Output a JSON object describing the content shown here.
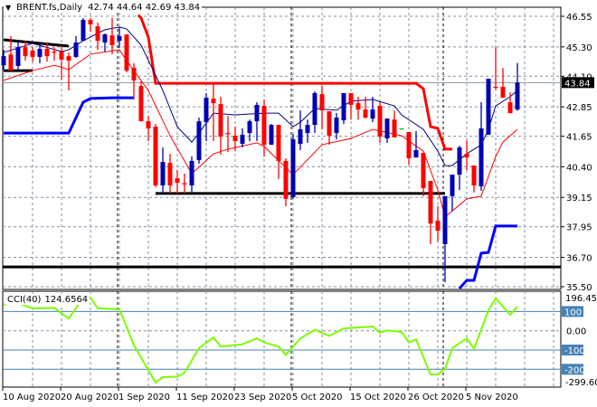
{
  "header": {
    "symbol": "BRENT.fs,Daily",
    "ohlc": "42.74 44.64 42.69 43.84"
  },
  "cci_header": {
    "name": "CCI(40)",
    "value": "124.6564"
  },
  "colors": {
    "bull": "#0000b0",
    "bear": "#ff0000",
    "doji": "#00c000",
    "ma": "#000080",
    "lower_env": "#ff0000",
    "upper_channel": "#ff0000",
    "lower_channel": "#0000ff",
    "cci": "#7cfc00",
    "level_box": "#4682b4"
  },
  "chart_data": [
    {
      "type": "candlestick",
      "title": "BRENT.fs,Daily",
      "ylim": [
        35.5,
        46.55
      ],
      "yticks": [
        "46.55",
        "45.30",
        "44.10",
        "42.85",
        "41.65",
        "40.40",
        "39.15",
        "37.95",
        "36.70",
        "35.50"
      ],
      "current_price": "43.84",
      "xticks": [
        {
          "bar": 0,
          "label": "10 Aug 2020"
        },
        {
          "bar": 8,
          "label": "20 Aug 2020"
        },
        {
          "bar": 16,
          "label": "1 Sep 2020"
        },
        {
          "bar": 24,
          "label": "11 Sep 2020"
        },
        {
          "bar": 32,
          "label": "23 Sep 2020"
        },
        {
          "bar": 40,
          "label": "5 Oct 2020"
        },
        {
          "bar": 48,
          "label": "15 Oct 2020"
        },
        {
          "bar": 56,
          "label": "26 Oct 2020"
        },
        {
          "bar": 64,
          "label": "5 Nov 2020"
        }
      ],
      "period_separators": [
        16,
        40,
        61
      ],
      "ohlc": [
        [
          44.55,
          45.18,
          44.37,
          44.92
        ],
        [
          44.99,
          45.74,
          44.33,
          44.33
        ],
        [
          44.52,
          45.55,
          44.37,
          45.29
        ],
        [
          45.29,
          45.55,
          44.74,
          44.92
        ],
        [
          45.15,
          45.29,
          44.7,
          44.89
        ],
        [
          44.89,
          45.44,
          44.63,
          45.22
        ],
        [
          45.22,
          45.48,
          44.7,
          44.92
        ],
        [
          45.11,
          45.29,
          44.74,
          45.07
        ],
        [
          45.11,
          45.33,
          43.96,
          44.78
        ],
        [
          44.92,
          45.07,
          43.52,
          44.74
        ],
        [
          44.89,
          45.74,
          44.85,
          45.48
        ],
        [
          45.55,
          46.48,
          45.55,
          46.4
        ],
        [
          46.4,
          46.48,
          45.92,
          46.22
        ],
        [
          46.14,
          46.29,
          45.18,
          45.55
        ],
        [
          45.48,
          45.85,
          45.11,
          45.81
        ],
        [
          45.77,
          46.48,
          45.0,
          45.37
        ],
        [
          45.55,
          46.11,
          45.26,
          45.74
        ],
        [
          45.81,
          45.81,
          44.26,
          44.33
        ],
        [
          44.44,
          44.63,
          43.15,
          43.93
        ],
        [
          43.7,
          43.89,
          42.26,
          42.26
        ],
        [
          42.26,
          42.48,
          41.45,
          41.97
        ],
        [
          42.04,
          42.15,
          39.57,
          39.64
        ],
        [
          39.64,
          41.19,
          39.31,
          40.6
        ],
        [
          40.56,
          40.93,
          39.31,
          39.64
        ],
        [
          39.93,
          40.27,
          39.31,
          39.75
        ],
        [
          39.73,
          40.12,
          39.31,
          39.7
        ],
        [
          39.64,
          40.82,
          39.31,
          40.64
        ],
        [
          40.67,
          42.41,
          40.53,
          42.26
        ],
        [
          42.22,
          43.41,
          41.45,
          43.22
        ],
        [
          43.18,
          43.81,
          41.45,
          43.0
        ],
        [
          42.96,
          43.26,
          40.89,
          41.63
        ],
        [
          41.78,
          42.48,
          41.0,
          41.74
        ],
        [
          41.67,
          42.04,
          41.04,
          41.45
        ],
        [
          41.34,
          41.97,
          41.19,
          41.71
        ],
        [
          41.78,
          42.33,
          41.45,
          42.26
        ],
        [
          42.26,
          43.04,
          41.45,
          42.93
        ],
        [
          42.89,
          43.15,
          40.82,
          41.3
        ],
        [
          41.3,
          42.15,
          41.3,
          42.11
        ],
        [
          42.11,
          42.11,
          39.9,
          40.64
        ],
        [
          40.64,
          40.75,
          38.79,
          39.09
        ],
        [
          39.16,
          41.74,
          39.09,
          41.52
        ],
        [
          41.34,
          42.7,
          41.08,
          41.93
        ],
        [
          41.78,
          42.33,
          41.38,
          42.11
        ],
        [
          42.11,
          43.48,
          41.78,
          43.41
        ],
        [
          43.37,
          43.7,
          41.93,
          42.7
        ],
        [
          42.67,
          42.67,
          41.3,
          41.67
        ],
        [
          41.78,
          42.6,
          41.52,
          42.41
        ],
        [
          42.3,
          43.41,
          42.15,
          43.41
        ],
        [
          43.41,
          43.41,
          42.33,
          42.93
        ],
        [
          43.0,
          43.26,
          42.33,
          42.74
        ],
        [
          42.74,
          43.26,
          42.37,
          42.41
        ],
        [
          42.37,
          43.26,
          42.22,
          42.74
        ],
        [
          42.89,
          43.04,
          41.38,
          41.63
        ],
        [
          41.56,
          42.37,
          41.38,
          42.37
        ],
        [
          42.33,
          42.7,
          41.6,
          41.6
        ],
        [
          41.97,
          41.97,
          41.97,
          41.97
        ],
        [
          41.82,
          41.82,
          40.49,
          40.75
        ],
        [
          40.78,
          41.86,
          40.78,
          41.08
        ],
        [
          40.97,
          40.97,
          39.2,
          39.53
        ],
        [
          39.82,
          39.82,
          37.24,
          38.08
        ],
        [
          38.2,
          38.79,
          37.35,
          37.79
        ],
        [
          37.24,
          39.2,
          35.68,
          39.2
        ],
        [
          39.2,
          40.08,
          38.6,
          40.08
        ],
        [
          40.08,
          41.26,
          39.45,
          41.19
        ],
        [
          40.93,
          41.48,
          40.27,
          40.78
        ],
        [
          40.45,
          40.45,
          39.35,
          39.64
        ],
        [
          39.6,
          43.04,
          39.42,
          41.97
        ],
        [
          41.71,
          44.0,
          41.71,
          44.0
        ],
        [
          43.67,
          45.29,
          43.56,
          43.63
        ],
        [
          43.67,
          44.44,
          43.22,
          43.22
        ],
        [
          43.04,
          43.44,
          42.59,
          42.59
        ],
        [
          42.74,
          44.64,
          42.69,
          43.84
        ]
      ],
      "lines": {
        "ma": [
          [
            0,
            45.07
          ],
          [
            4,
            45.44
          ],
          [
            8,
            45.11
          ],
          [
            9,
            45.18
          ],
          [
            11,
            45.55
          ],
          [
            14,
            46.0
          ],
          [
            16,
            46.11
          ],
          [
            17,
            46.03
          ],
          [
            19,
            45.37
          ],
          [
            22,
            43.52
          ],
          [
            24,
            42.04
          ],
          [
            26,
            41.41
          ],
          [
            27,
            41.78
          ],
          [
            29,
            42.59
          ],
          [
            32,
            42.52
          ],
          [
            36,
            42.59
          ],
          [
            38,
            42.59
          ],
          [
            40,
            42.04
          ],
          [
            41,
            42.22
          ],
          [
            43,
            42.78
          ],
          [
            46,
            42.71
          ],
          [
            48,
            43.08
          ],
          [
            51,
            43.15
          ],
          [
            54,
            42.89
          ],
          [
            55,
            42.52
          ],
          [
            58,
            41.93
          ],
          [
            60,
            41.04
          ],
          [
            61,
            40.45
          ],
          [
            62,
            40.45
          ],
          [
            64,
            40.93
          ],
          [
            66,
            41.3
          ],
          [
            67,
            41.93
          ],
          [
            68,
            42.89
          ],
          [
            70,
            43.26
          ],
          [
            71,
            43.52
          ]
        ],
        "lower_env": [
          [
            0,
            43.93
          ],
          [
            4,
            44.33
          ],
          [
            7,
            44.55
          ],
          [
            9,
            44.37
          ],
          [
            12,
            45.0
          ],
          [
            16,
            45.18
          ],
          [
            17,
            44.74
          ],
          [
            20,
            43.52
          ],
          [
            23,
            41.67
          ],
          [
            26,
            40.12
          ],
          [
            29,
            40.93
          ],
          [
            31,
            41.12
          ],
          [
            35,
            41.38
          ],
          [
            36,
            41.23
          ],
          [
            40,
            40.08
          ],
          [
            44,
            41.3
          ],
          [
            48,
            41.56
          ],
          [
            51,
            41.93
          ],
          [
            55,
            41.67
          ],
          [
            58,
            41.04
          ],
          [
            60,
            39.45
          ],
          [
            61,
            38.35
          ],
          [
            64,
            39.09
          ],
          [
            66,
            39.2
          ],
          [
            68,
            40.82
          ],
          [
            69,
            41.41
          ],
          [
            71,
            41.93
          ]
        ],
        "upper_channel": [
          [
            18.6,
            46.6
          ],
          [
            19,
            46.48
          ],
          [
            20,
            45.7
          ],
          [
            21,
            43.81
          ],
          [
            57,
            43.81
          ],
          [
            58,
            43.59
          ],
          [
            59,
            42.04
          ],
          [
            60,
            41.97
          ],
          [
            61,
            41.12
          ],
          [
            62,
            41.12
          ]
        ],
        "lower_channel": [
          [
            0,
            41.78
          ],
          [
            9,
            41.78
          ],
          [
            11,
            43.04
          ],
          [
            12,
            43.19
          ],
          [
            15,
            43.22
          ],
          [
            18,
            43.22
          ]
        ],
        "lower_channel_2": [
          [
            63,
            35.43
          ],
          [
            64,
            35.76
          ],
          [
            65,
            35.76
          ],
          [
            66,
            36.87
          ],
          [
            67,
            36.9
          ],
          [
            68,
            37.98
          ],
          [
            71,
            37.98
          ]
        ],
        "trend_1": [
          [
            0,
            45.59
          ],
          [
            9,
            45.33
          ]
        ],
        "level_1": [
          [
            0,
            44.33
          ],
          [
            4,
            44.33
          ]
        ],
        "level_2": [
          [
            21,
            39.31
          ],
          [
            61,
            39.31
          ]
        ],
        "level_3": [
          [
            -1,
            36.31
          ],
          [
            77,
            36.31
          ]
        ]
      }
    },
    {
      "type": "line",
      "title": "CCI(40)",
      "ylim": [
        -299.603,
        196.4581
      ],
      "ytick_labels": {
        "max": "196.4581",
        "l100": "100",
        "l0": "0.00",
        "lm100": "-100",
        "lm200": "-200",
        "min": "-299.603"
      },
      "levels": [
        100,
        0,
        -100,
        -200
      ],
      "series": [
        [
          0,
          136
        ],
        [
          2,
          144
        ],
        [
          4,
          116
        ],
        [
          7,
          119
        ],
        [
          9,
          63
        ],
        [
          11,
          172
        ],
        [
          12,
          172
        ],
        [
          13,
          117
        ],
        [
          16,
          111
        ],
        [
          18,
          -75
        ],
        [
          21,
          -269
        ],
        [
          22,
          -241
        ],
        [
          24,
          -238
        ],
        [
          25,
          -218
        ],
        [
          27,
          -90
        ],
        [
          29,
          -35
        ],
        [
          30,
          -82
        ],
        [
          33,
          -70
        ],
        [
          35,
          -40
        ],
        [
          36,
          -60
        ],
        [
          38,
          -82
        ],
        [
          39,
          -125
        ],
        [
          41,
          -40
        ],
        [
          43,
          5
        ],
        [
          45,
          -27
        ],
        [
          47,
          12
        ],
        [
          51,
          22
        ],
        [
          52,
          -10
        ],
        [
          53,
          2
        ],
        [
          55,
          -6
        ],
        [
          56,
          -61
        ],
        [
          57,
          -45
        ],
        [
          59,
          -227
        ],
        [
          60,
          -227
        ],
        [
          61,
          -199
        ],
        [
          62,
          -90
        ],
        [
          64,
          -40
        ],
        [
          65,
          -93
        ],
        [
          67,
          106
        ],
        [
          68,
          168
        ],
        [
          70,
          83
        ],
        [
          71,
          125
        ]
      ]
    }
  ]
}
